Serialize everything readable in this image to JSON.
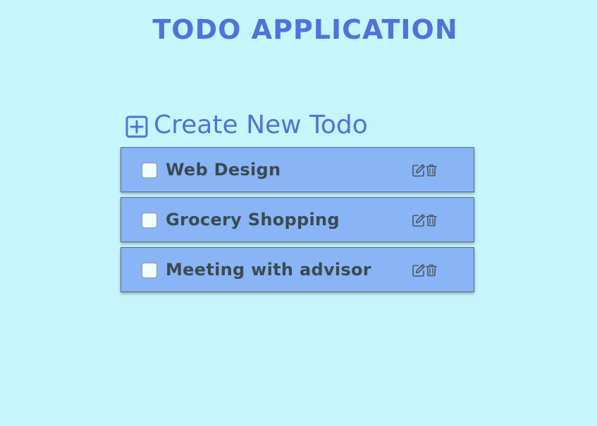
{
  "header": {
    "title": "TODO APPLICATION"
  },
  "create": {
    "label": "Create New Todo",
    "icon": "plus-square-icon"
  },
  "todos": [
    {
      "text": "Web Design",
      "checked": false
    },
    {
      "text": "Grocery Shopping",
      "checked": false
    },
    {
      "text": "Meeting with advisor",
      "checked": false
    }
  ],
  "icons": {
    "edit": "pencil-square-icon",
    "delete": "trash-icon"
  },
  "colors": {
    "background": "#c6f6fc",
    "accent": "#4f72e0",
    "card": "#89b5f6",
    "text": "#3c4a4f"
  }
}
